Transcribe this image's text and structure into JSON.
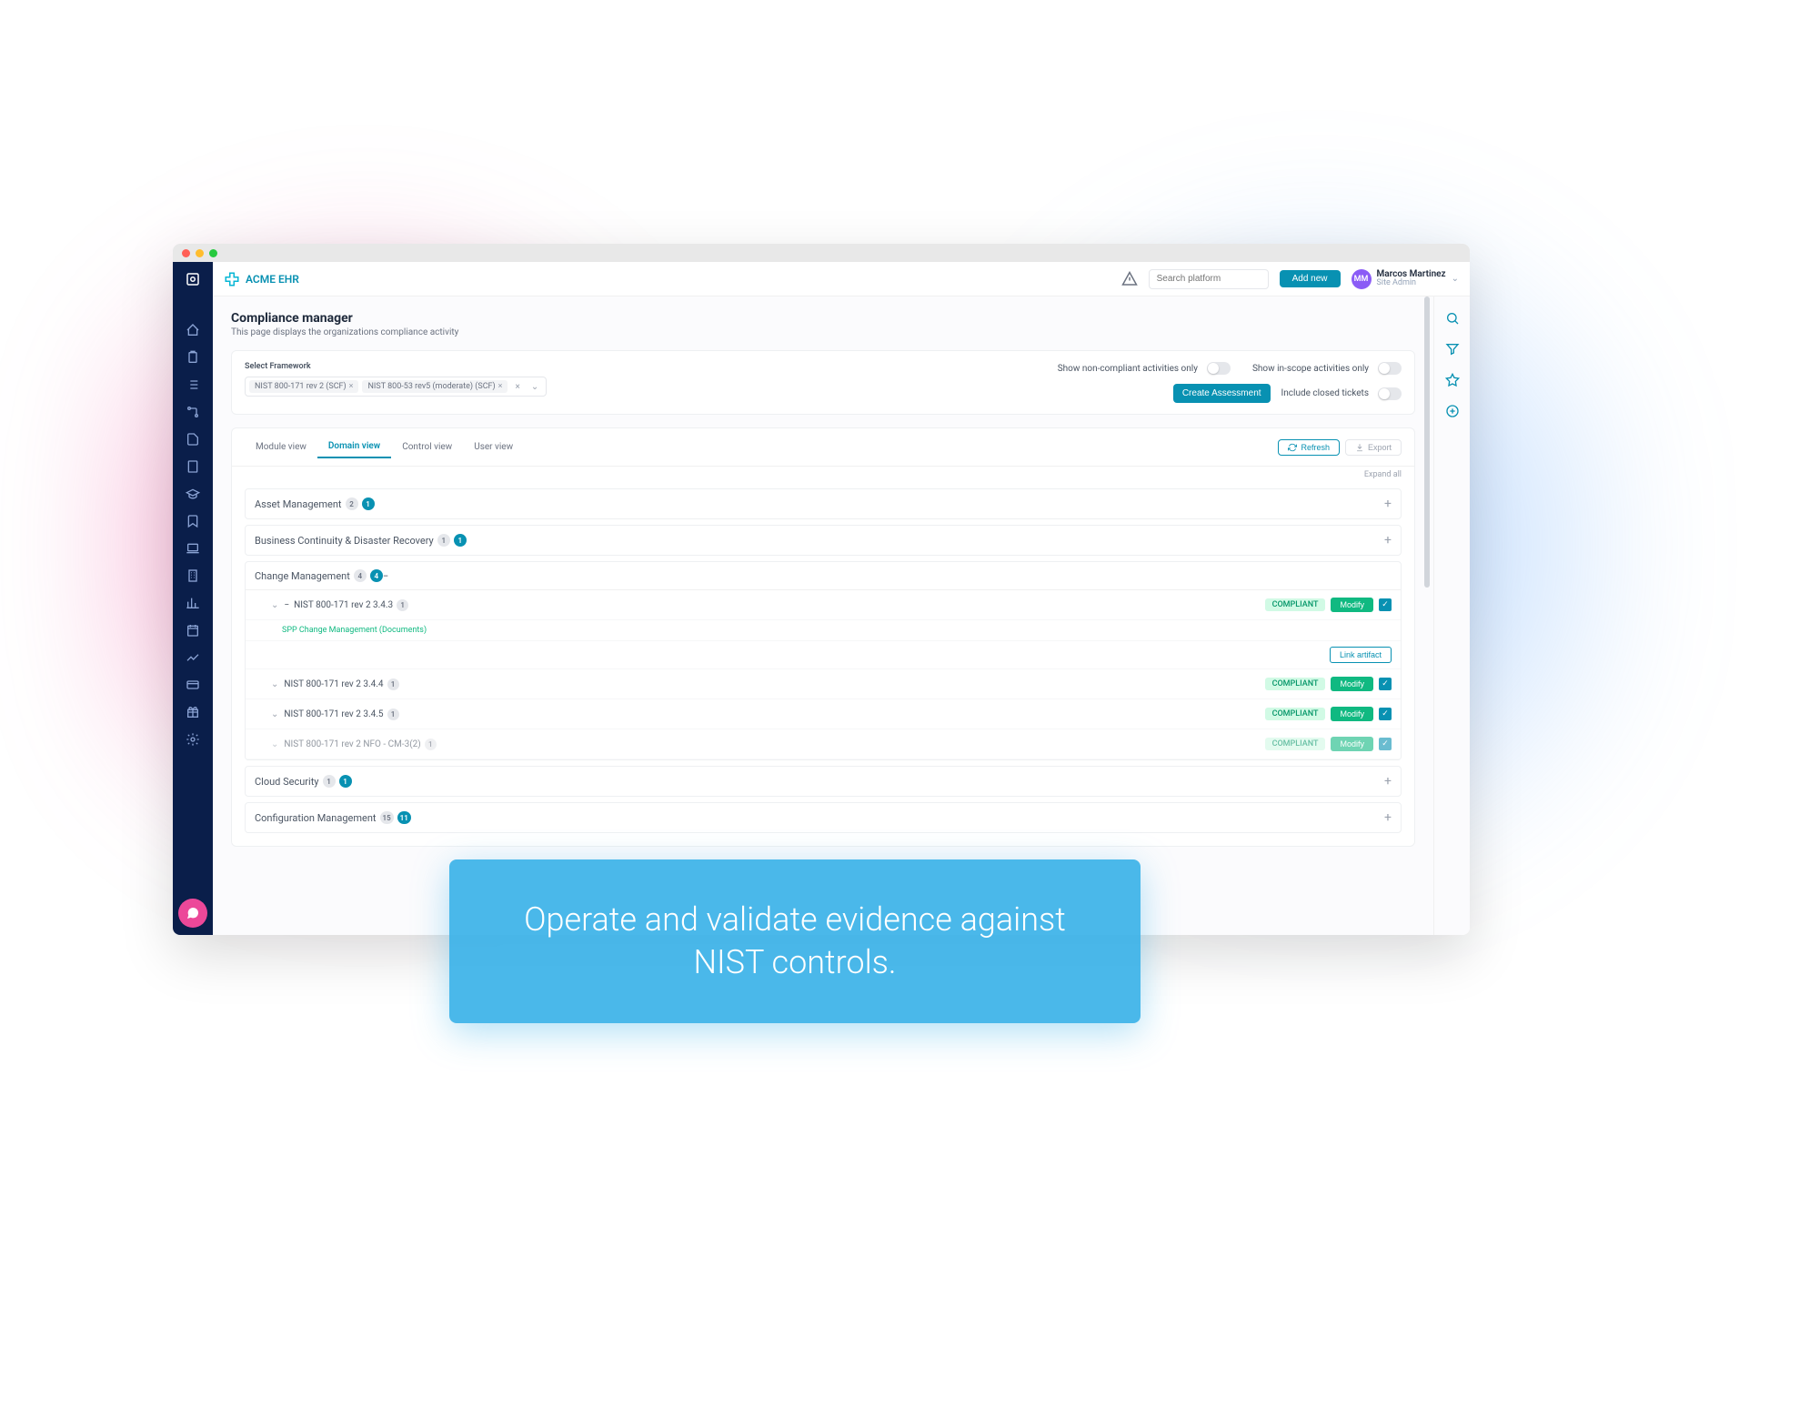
{
  "brand": {
    "name": "ACME EHR"
  },
  "header": {
    "search_placeholder": "Search platform",
    "add_new": "Add new",
    "user_initials": "MM",
    "user_name": "Marcos Martinez",
    "user_role": "Site Admin"
  },
  "page": {
    "title": "Compliance manager",
    "subtitle": "This page displays the organizations compliance activity"
  },
  "filter": {
    "label": "Select Framework",
    "chips": [
      {
        "label": "NIST 800-171 rev 2 (SCF)"
      },
      {
        "label": "NIST 800-53 rev5 (moderate) (SCF)"
      }
    ],
    "toggle1": "Show non-compliant activities only",
    "toggle2": "Show in-scope activities only",
    "toggle3": "Include closed tickets",
    "create": "Create Assessment"
  },
  "tabs": {
    "items": [
      "Module view",
      "Domain view",
      "Control view",
      "User view"
    ],
    "active_index": 1,
    "refresh": "Refresh",
    "export": "Export",
    "expand_all": "Expand all"
  },
  "domains": {
    "asset": {
      "name": "Asset Management",
      "g": "2",
      "b": "1"
    },
    "bcdr": {
      "name": "Business Continuity & Disaster Recovery",
      "g": "1",
      "b": "1"
    },
    "change": {
      "name": "Change Management",
      "g": "4",
      "b": "4"
    },
    "cloud": {
      "name": "Cloud Security",
      "g": "1",
      "b": "1"
    },
    "config": {
      "name": "Configuration Management",
      "g": "15",
      "b": "11"
    }
  },
  "controls": {
    "c1": {
      "name": "NIST 800-171 rev 2 3.4.3",
      "count": "1",
      "status": "COMPLIANT",
      "modify": "Modify"
    },
    "c1doc": "SPP Change Management (Documents)",
    "link_artifact": "Link artifact",
    "c2": {
      "name": "NIST 800-171 rev 2 3.4.4",
      "count": "1",
      "status": "COMPLIANT",
      "modify": "Modify"
    },
    "c3": {
      "name": "NIST 800-171 rev 2 3.4.5",
      "count": "1",
      "status": "COMPLIANT",
      "modify": "Modify"
    },
    "c4": {
      "name": "NIST 800-171 rev 2 NFO - CM-3(2)",
      "count": "1",
      "status": "COMPLIANT",
      "modify": "Modify"
    }
  },
  "caption": "Operate and validate evidence against NIST controls."
}
